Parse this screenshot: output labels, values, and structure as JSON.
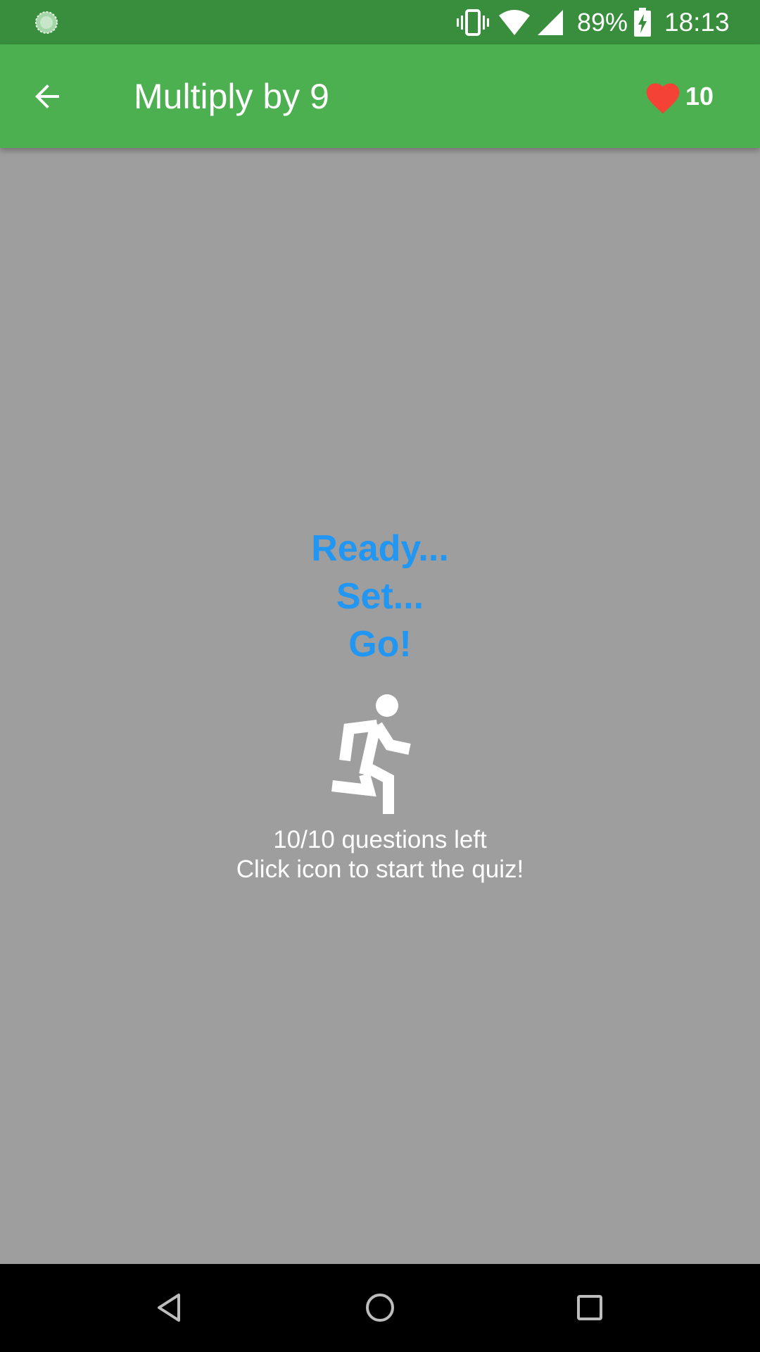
{
  "status_bar": {
    "battery_percent": "89%",
    "time": "18:13",
    "icons": [
      "notification-icon",
      "vibrate-icon",
      "wifi-icon",
      "signal-icon",
      "battery-charging-icon"
    ]
  },
  "app_bar": {
    "title": "Multiply by 9",
    "lives_count": "10",
    "colors": {
      "bar": "#4caf50",
      "status": "#388e3c",
      "heart": "#f44336"
    }
  },
  "main": {
    "ready_lines": [
      "Ready...",
      "Set...",
      "Go!"
    ],
    "ready_color": "#2196f3",
    "questions_left": "10/10 questions left",
    "instruction": "Click icon to start the quiz!",
    "start_icon": "directions-run-icon"
  },
  "nav_bar": {
    "buttons": [
      "back-triangle-icon",
      "home-circle-icon",
      "recent-square-icon"
    ]
  }
}
